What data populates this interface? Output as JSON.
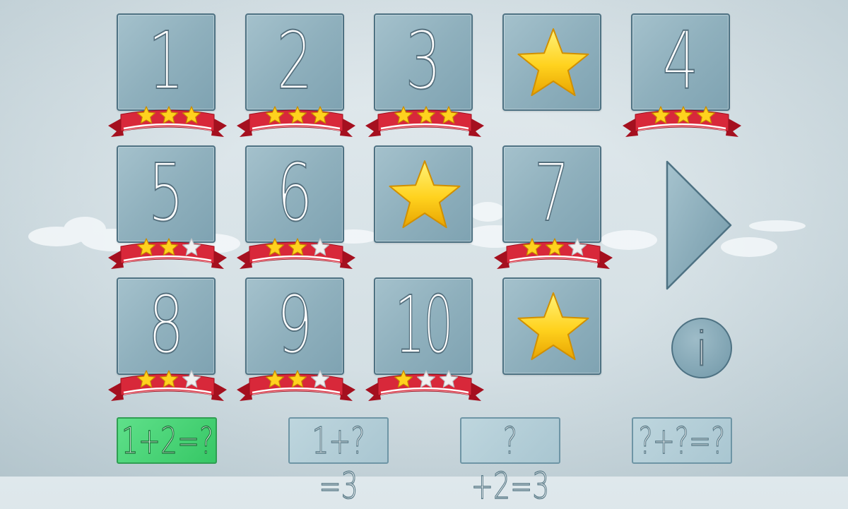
{
  "levels": [
    {
      "label": "1",
      "stars": 3
    },
    {
      "label": "2",
      "stars": 3
    },
    {
      "label": "3",
      "stars": 3
    },
    {
      "label": "4",
      "stars": 3
    },
    {
      "label": "5",
      "stars": 2
    },
    {
      "label": "6",
      "stars": 2
    },
    {
      "label": "7",
      "stars": 2
    },
    {
      "label": "8",
      "stars": 2
    },
    {
      "label": "9",
      "stars": 2
    },
    {
      "label": "10",
      "stars": 1
    }
  ],
  "max_stars": 3,
  "bonus_tiles": 3,
  "info_label": "i",
  "modes": [
    {
      "label": "1+2=?",
      "selected": true
    },
    {
      "label": "1+?=3",
      "selected": false
    },
    {
      "label": "?+2=3",
      "selected": false
    },
    {
      "label": "?+?=?",
      "selected": false
    }
  ],
  "colors": {
    "tile": "#8fb0bd",
    "tile_border": "#4e7283",
    "ribbon": "#d8283a",
    "star_filled": "#ffd21e",
    "star_empty": "#f0f0f0",
    "mode_active": "#45d170",
    "mode_inactive": "#b3ced8"
  }
}
